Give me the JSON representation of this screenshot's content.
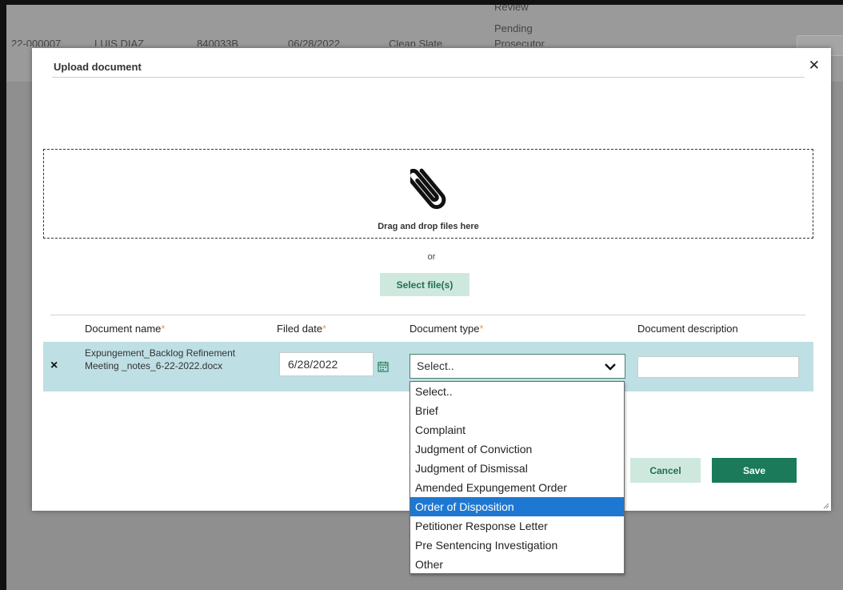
{
  "background": {
    "row_status_1": "Review",
    "row_status_2": "Pending",
    "row_status_3": "Prosecutor",
    "row_case": "22-000007",
    "row_name": "LUIS DIAZ",
    "row_code": "840033B",
    "row_date": "06/28/2022",
    "row_type": "Clean Slate"
  },
  "modal": {
    "title": "Upload document",
    "close_icon": "close-icon",
    "dropzone_text": "Drag and drop files here",
    "dropzone_icon": "paperclip-icon",
    "or_text": "or",
    "select_files_label": "Select file(s)",
    "columns": {
      "document_name": "Document name",
      "filed_date": "Filed date",
      "document_type": "Document type",
      "document_description": "Document description",
      "required_marker": "*"
    },
    "file_row": {
      "remove_label": "×",
      "file_name": "Expungement_Backlog Refinement Meeting _notes_6-22-2022.docx",
      "filed_date": "6/28/2022",
      "document_type_value": "Select..",
      "document_description": ""
    },
    "cancel_label": "Cancel",
    "save_label": "Save"
  },
  "dropdown": {
    "options": [
      "Select..",
      "Brief",
      "Complaint",
      "Judgment of Conviction",
      "Judgment of Dismissal",
      "Amended Expungement Order",
      "Order of Disposition",
      "Petitioner Response Letter",
      "Pre Sentencing Investigation",
      "Other"
    ],
    "highlighted": "Order of Disposition"
  },
  "colors": {
    "accent": "#1a7a5a",
    "accent_light": "#cfe8de",
    "row_bg": "#bedfe4",
    "highlight": "#1e78d2",
    "required": "#e0a34a"
  }
}
